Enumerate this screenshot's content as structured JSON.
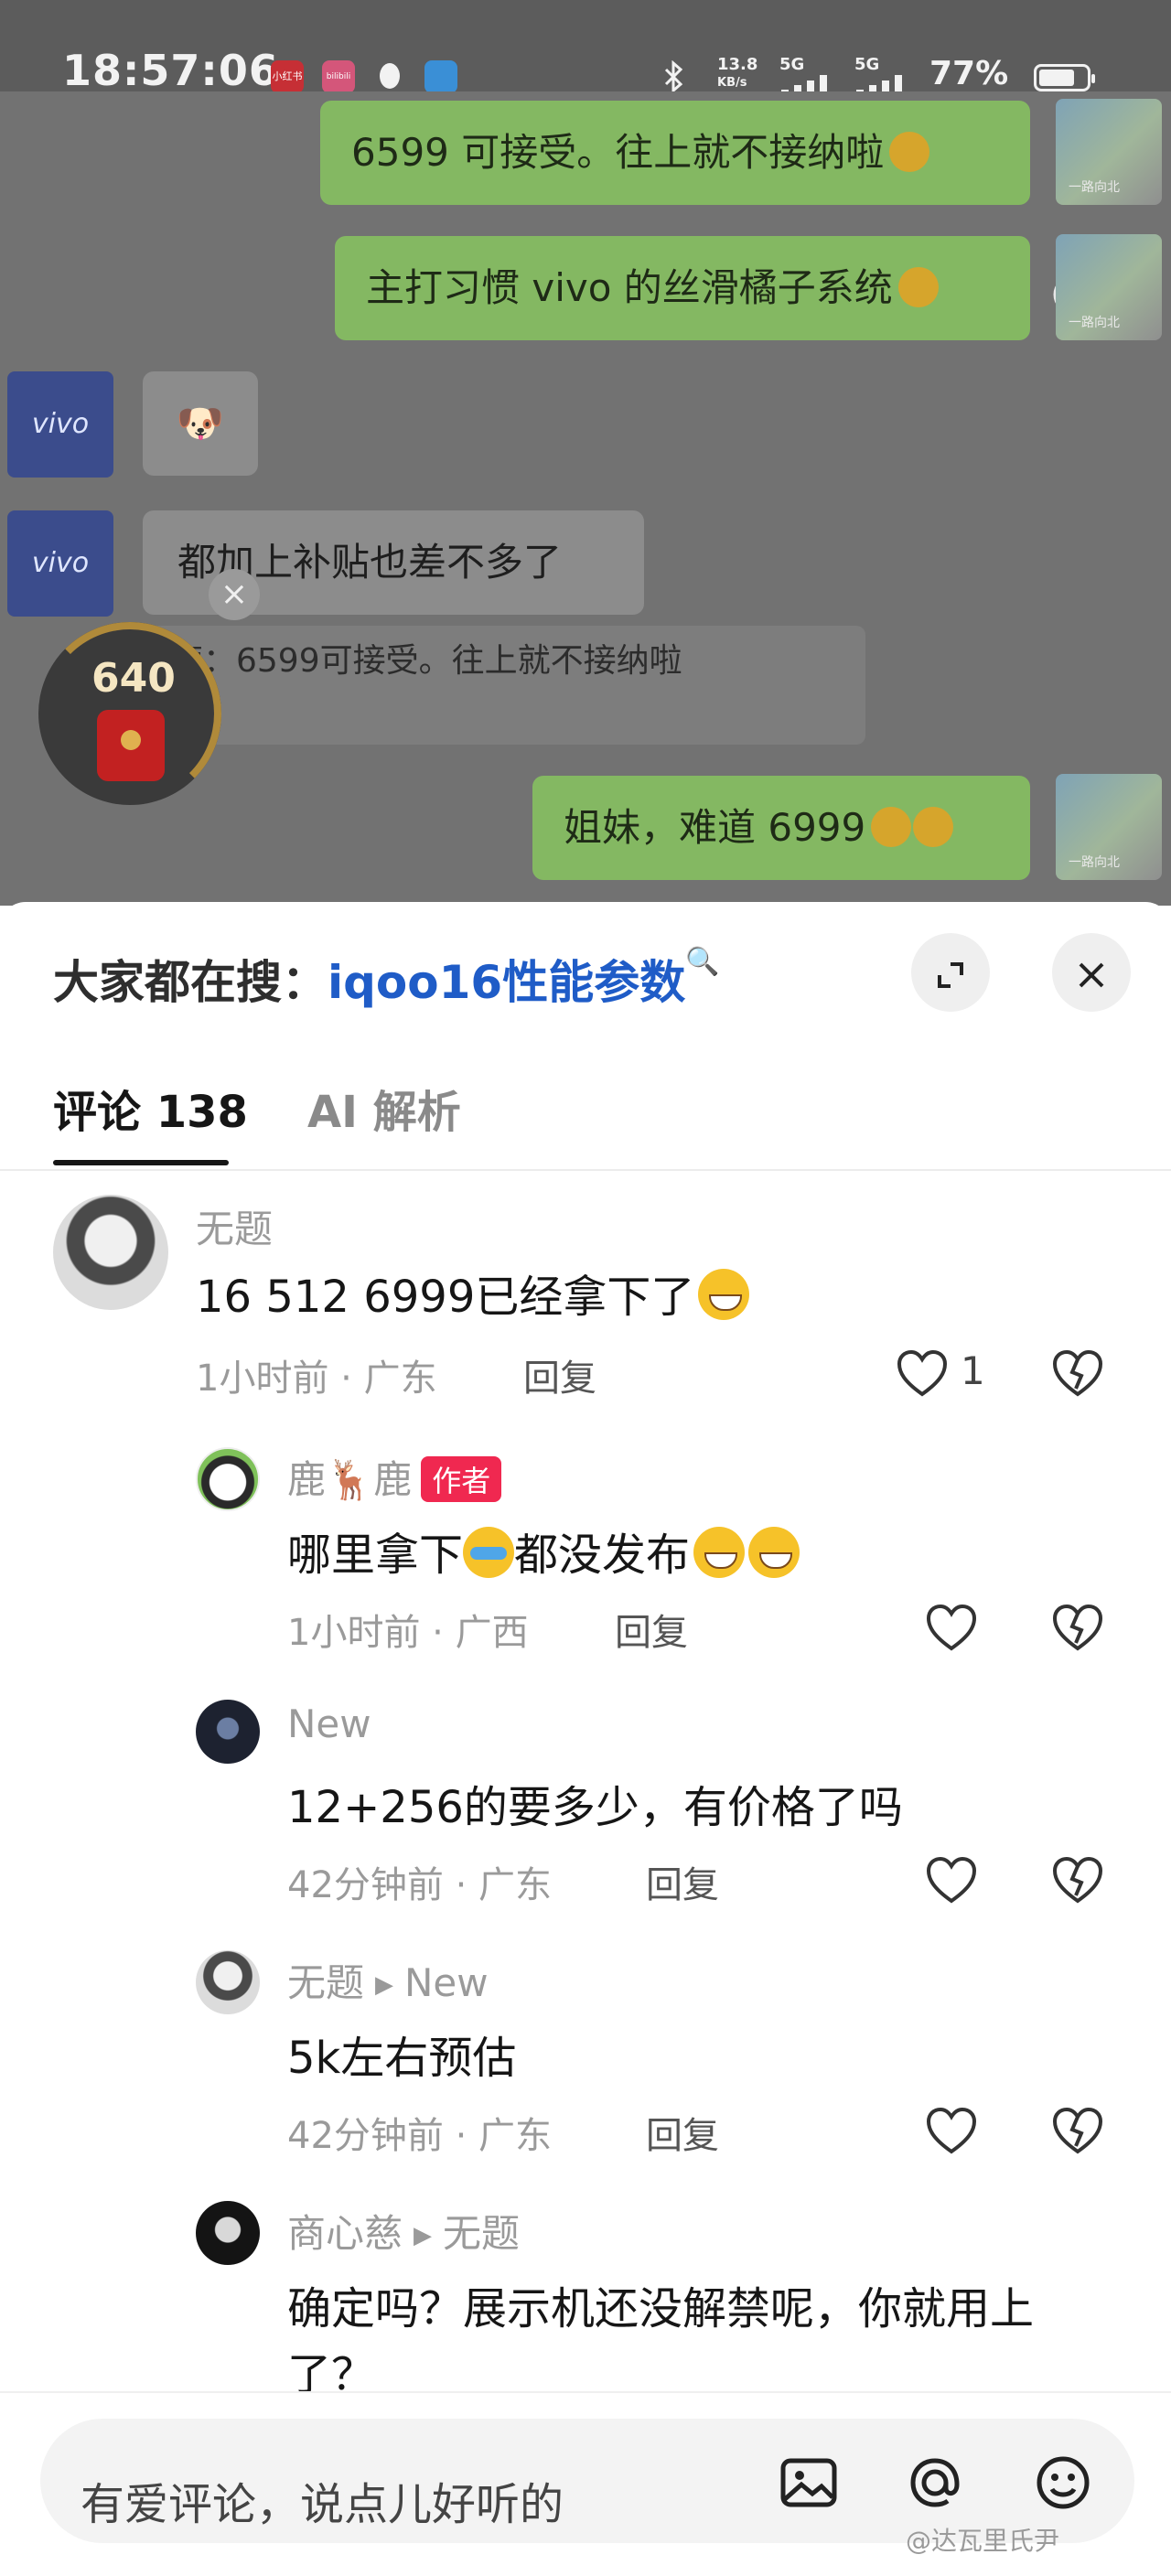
{
  "status_bar": {
    "time": "18:57:06",
    "apps": [
      "小红书",
      "bilibili"
    ],
    "net_speed": "13.8",
    "net_unit": "KB/s",
    "signal1": "5G",
    "signal2": "5G",
    "battery": "77%"
  },
  "chat": {
    "messages": [
      {
        "side": "right",
        "text": "6599 可接受。往上就不接纳啦"
      },
      {
        "side": "right",
        "text": "主打习惯 vivo 的丝滑橘子系统"
      },
      {
        "side": "left",
        "sender": "vivo",
        "text": "🐶"
      },
      {
        "side": "left",
        "sender": "vivo",
        "text": "都加上补贴也差不多了"
      },
      {
        "side": "right",
        "text": "姐妹，难道 6999"
      }
    ],
    "quote": {
      "prefix": "鹿",
      "text": "鹿：6599可接受。往上就不接纳啦"
    },
    "float_widget": {
      "count": "640"
    }
  },
  "sheet": {
    "trending_label": "大家都在搜：",
    "trending_keyword": "iqoo16性能参数",
    "tabs": [
      {
        "label": "评论 138",
        "active": true
      },
      {
        "label": "AI 解析",
        "active": false
      }
    ],
    "comments": [
      {
        "name": "无题",
        "text": "16 512 6999已经拿下了",
        "time": "1小时前 · 广东",
        "reply": "回复",
        "likes": "1"
      },
      {
        "name": "鹿🦌鹿",
        "badge": "作者",
        "text_a": "哪里拿下",
        "text_b": "都没发布",
        "time": "1小时前 · 广西",
        "reply": "回复"
      },
      {
        "name": "New",
        "text": "12+256的要多少，有价格了吗",
        "time": "42分钟前 · 广东",
        "reply": "回复"
      },
      {
        "name": "无题",
        "reply_to": "New",
        "text": "5k左右预估",
        "time": "42分钟前 · 广东",
        "reply": "回复"
      },
      {
        "name": "商心慈",
        "reply_to": "无题",
        "text": "确定吗？展示机还没解禁呢，你就用上",
        "text2": "了？"
      }
    ]
  },
  "input_bar": {
    "placeholder": "有爱评论，说点儿好听的",
    "watermark": "@达瓦里氏尹"
  },
  "colors": {
    "accent_blue": "#1f5cc7",
    "author_badge": "#f02850",
    "chat_green": "#84b862"
  },
  "icons": [
    "bluetooth-icon",
    "signal-icon",
    "battery-icon",
    "search-icon",
    "expand-icon",
    "close-icon",
    "heart-icon",
    "broken-heart-icon",
    "image-icon",
    "at-icon",
    "emoji-icon"
  ]
}
